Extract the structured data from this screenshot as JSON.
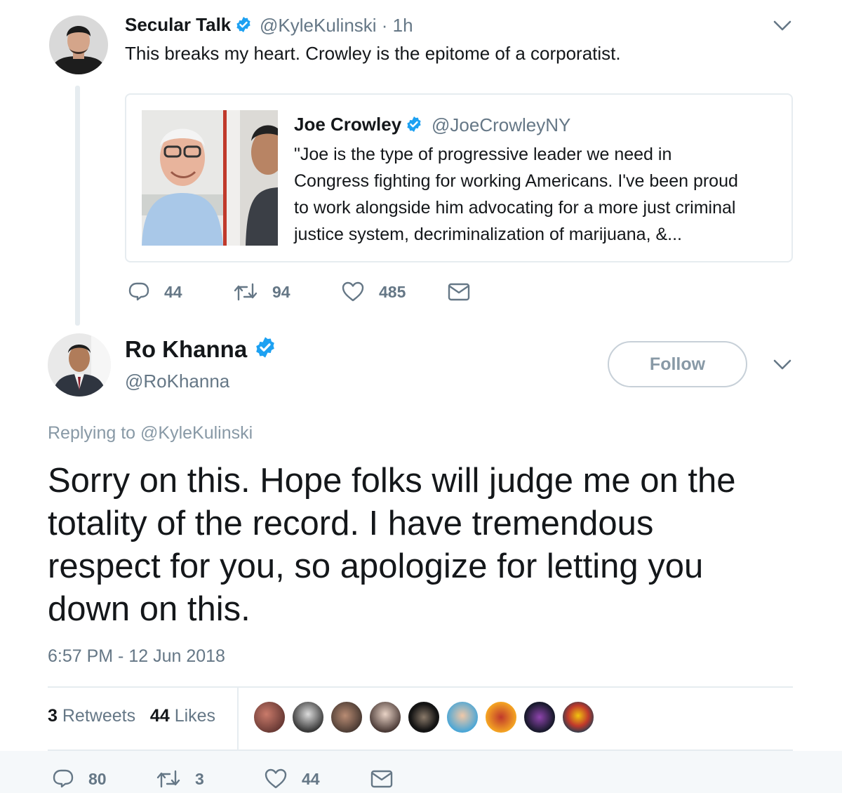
{
  "parent_tweet": {
    "name": "Secular Talk",
    "handle": "@KyleKulinski",
    "time": "· 1h",
    "text": "This breaks my heart. Crowley is the epitome of a corporatist.",
    "quote": {
      "name": "Joe Crowley",
      "handle": "@JoeCrowleyNY",
      "lines": [
        "\"Joe is the type of progressive leader we need in",
        "Congress fighting for working Americans. I've been proud",
        "to work alongside him advocating for a more just criminal",
        "justice system, decriminalization of marijuana, &..."
      ]
    },
    "actions": {
      "replies": "44",
      "retweets": "94",
      "likes": "485"
    }
  },
  "main_tweet": {
    "name": "Ro Khanna",
    "handle": "@RoKhanna",
    "follow_label": "Follow",
    "replying_prefix": "Replying to",
    "replying_handle": "@KyleKulinski",
    "lines": [
      "Sorry on this. Hope folks will judge me on the",
      "totality of the record. I have tremendous",
      "respect for you, so apologize for letting you",
      "down on this."
    ],
    "timestamp": "6:57 PM - 12 Jun 2018",
    "retweets_count": "3",
    "retweets_label": "Retweets",
    "likes_count": "44",
    "likes_label": "Likes",
    "actions": {
      "replies": "80",
      "retweets": "3",
      "likes": "44"
    }
  },
  "icons": {
    "verified": "verified-badge-icon",
    "reply": "reply-icon",
    "retweet": "retweet-icon",
    "like": "heart-icon",
    "dm": "envelope-icon",
    "menu": "chevron-down-icon"
  },
  "colors": {
    "verified": "#1da1f2",
    "text": "#14171a",
    "muted": "#657786",
    "border": "#e6ecf0"
  }
}
